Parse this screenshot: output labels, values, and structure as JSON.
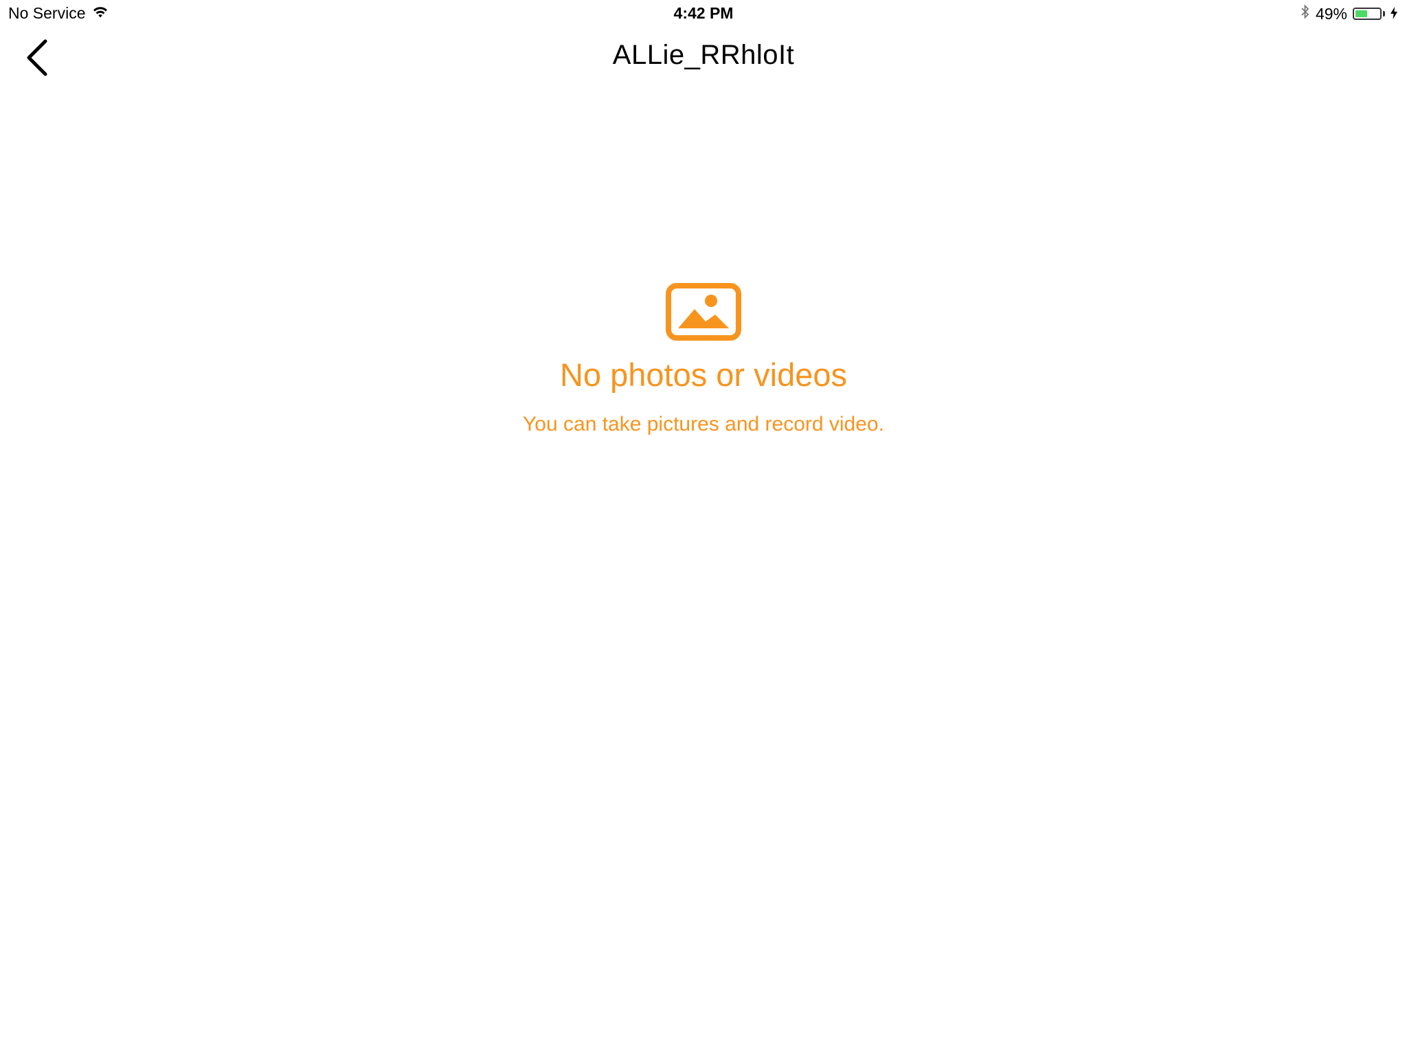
{
  "status_bar": {
    "carrier": "No Service",
    "time": "4:42 PM",
    "battery_percent": "49%",
    "battery_level": 0.49,
    "icons": [
      "wifi-icon",
      "bluetooth-icon",
      "battery-icon",
      "charging-bolt-icon"
    ]
  },
  "nav": {
    "title": "ALLie_RRhloIt",
    "back_icon": "chevron-left-icon"
  },
  "empty_state": {
    "icon": "photo-icon",
    "title": "No photos or videos",
    "subtitle": "You can take pictures and record video."
  },
  "colors": {
    "accent": "#F7941E",
    "background": "#FFFFFF",
    "text": "#000000",
    "battery": "#4CD964"
  }
}
